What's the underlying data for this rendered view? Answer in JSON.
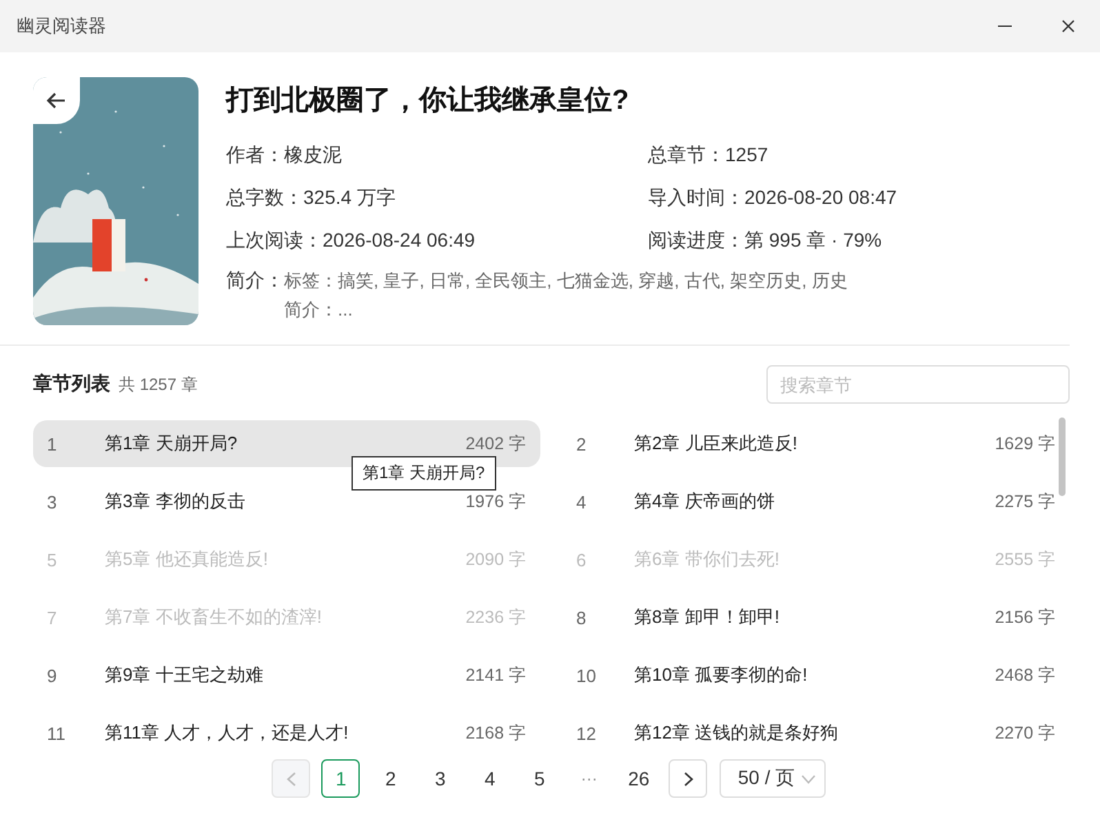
{
  "window": {
    "title": "幽灵阅读器"
  },
  "book": {
    "title": "打到北极圈了，你让我继承皇位?",
    "meta": [
      {
        "text": "作者：橡皮泥"
      },
      {
        "text": "总章节：1257"
      },
      {
        "text": "总字数：325.4 万字"
      },
      {
        "text": "导入时间：2026-08-20 08:47"
      },
      {
        "text": "上次阅读：2026-08-24 06:49"
      },
      {
        "text": "阅读进度：第 995 章 · 79%"
      }
    ],
    "synopsis": {
      "label": "简介：",
      "lines": [
        "标签：搞笑, 皇子, 日常, 全民领主, 七猫金选, 穿越, 古代, 架空历史, 历史",
        "简介：..."
      ]
    }
  },
  "chapter_list": {
    "title": "章节列表",
    "count": "共 1257 章",
    "search": {
      "placeholder": "搜索章节"
    },
    "chapters": [
      {
        "number": "1",
        "title": "第1章 天崩开局?",
        "words": "2402 字",
        "selected": true,
        "muted": false
      },
      {
        "number": "2",
        "title": "第2章 儿臣来此造反!",
        "words": "1629 字",
        "selected": false,
        "muted": false
      },
      {
        "number": "3",
        "title": "第3章 李彻的反击",
        "words": "1976 字",
        "selected": false,
        "muted": false
      },
      {
        "number": "4",
        "title": "第4章 庆帝画的饼",
        "words": "2275 字",
        "selected": false,
        "muted": false
      },
      {
        "number": "5",
        "title": "第5章 他还真能造反!",
        "words": "2090 字",
        "selected": false,
        "muted": true
      },
      {
        "number": "6",
        "title": "第6章 带你们去死!",
        "words": "2555 字",
        "selected": false,
        "muted": true
      },
      {
        "number": "7",
        "title": "第7章 不收畜生不如的渣滓!",
        "words": "2236 字",
        "selected": false,
        "muted": true
      },
      {
        "number": "8",
        "title": "第8章 卸甲！卸甲!",
        "words": "2156 字",
        "selected": false,
        "muted": false
      },
      {
        "number": "9",
        "title": "第9章 十王宅之劫难",
        "words": "2141 字",
        "selected": false,
        "muted": false
      },
      {
        "number": "10",
        "title": "第10章 孤要李彻的命!",
        "words": "2468 字",
        "selected": false,
        "muted": false
      },
      {
        "number": "11",
        "title": "第11章 人才，人才，还是人才!",
        "words": "2168 字",
        "selected": false,
        "muted": false
      },
      {
        "number": "12",
        "title": "第12章 送钱的就是条好狗",
        "words": "2270 字",
        "selected": false,
        "muted": false
      }
    ],
    "tooltip": "第1章 天崩开局?"
  },
  "pagination": {
    "previous_disabled": true,
    "pages": [
      {
        "label": "1",
        "kind": "page",
        "selected": true
      },
      {
        "label": "2",
        "kind": "page",
        "selected": false
      },
      {
        "label": "3",
        "kind": "page",
        "selected": false
      },
      {
        "label": "4",
        "kind": "page",
        "selected": false
      },
      {
        "label": "5",
        "kind": "page",
        "selected": false
      },
      {
        "label": "···",
        "kind": "ellipsis"
      },
      {
        "label": "26",
        "kind": "page",
        "selected": false
      }
    ],
    "page_size": "50 / 页"
  }
}
